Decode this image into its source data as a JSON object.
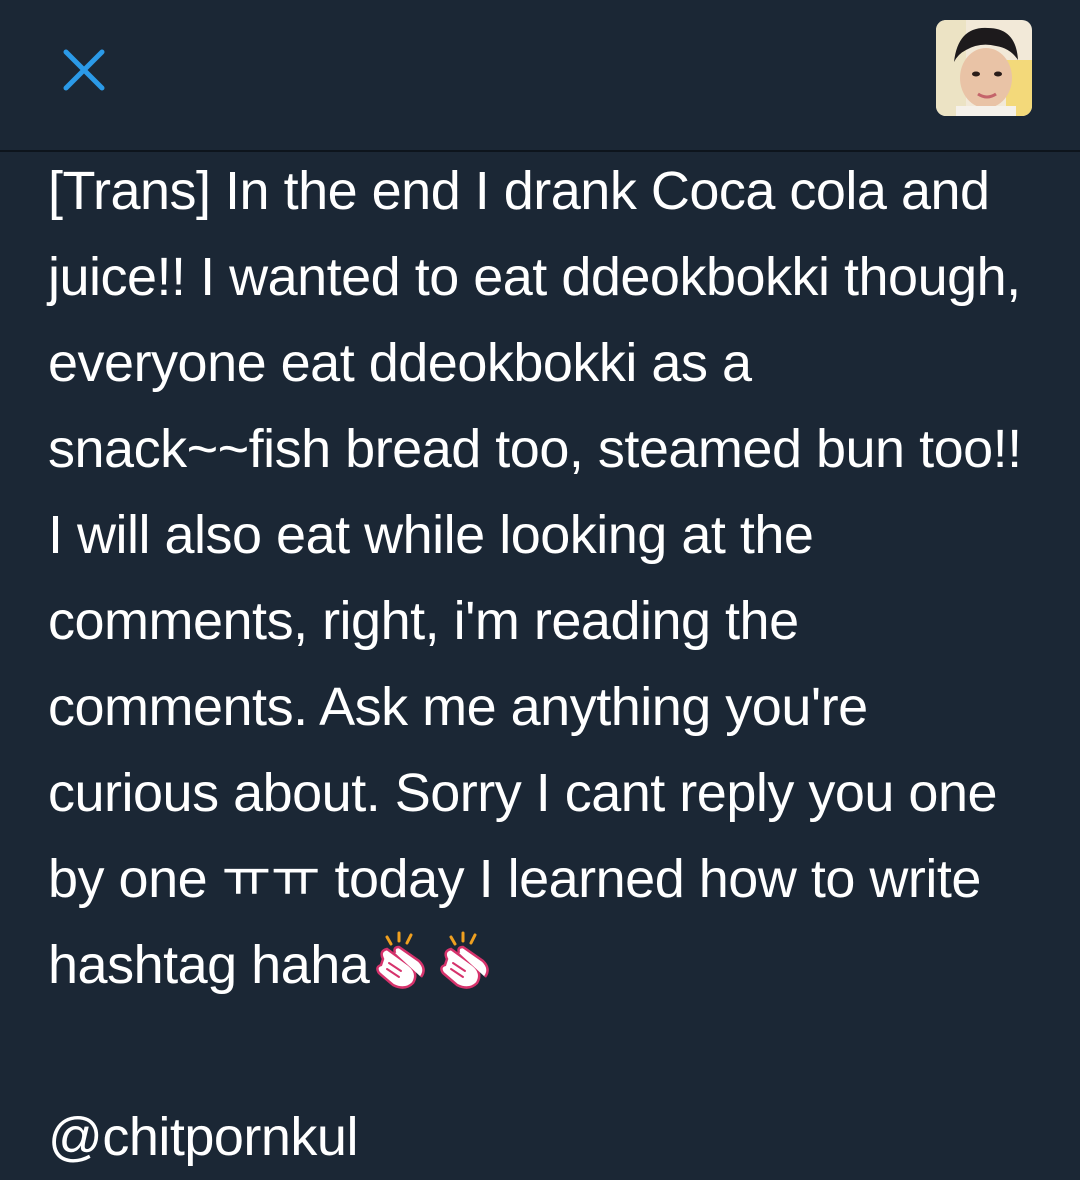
{
  "header": {
    "close_icon": "close-icon",
    "avatar_icon": "profile-avatar",
    "accent_color": "#2b9ae8",
    "background_color": "#1b2735"
  },
  "tweet": {
    "text": "[Trans] In the end I drank Coca cola and juice!! I wanted to eat ddeokbokki though, everyone eat ddeokbokki as a snack~~fish bread too, steamed bun too!! I will also eat while looking at the comments, right, i'm reading the comments. Ask me anything you're curious about. Sorry I cant reply you one by one ㅠㅠ today I learned how to write hashtag haha",
    "emojis": [
      "clapping-hands-emoji",
      "clapping-hands-emoji"
    ],
    "mention": "@chitpornkul"
  }
}
